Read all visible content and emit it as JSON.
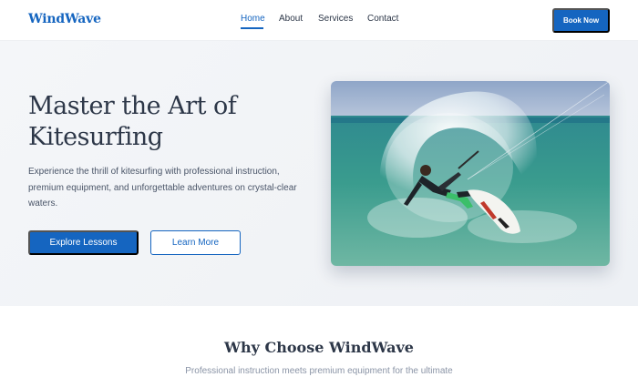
{
  "header": {
    "logo": "WindWave",
    "nav": [
      {
        "label": "Home",
        "active": true
      },
      {
        "label": "About",
        "active": false
      },
      {
        "label": "Services",
        "active": false
      },
      {
        "label": "Contact",
        "active": false
      }
    ],
    "cta": "Book Now"
  },
  "hero": {
    "title_line1": "Master the Art of",
    "title_line2": "Kitesurfing",
    "description": "Experience the thrill of kitesurfing with professional instruction, premium equipment, and unforgettable adventures on crystal-clear waters.",
    "primary_button": "Explore Lessons",
    "secondary_button": "Learn More",
    "image_subject": "kitesurfer-carving-wave-photo"
  },
  "why": {
    "title": "Why Choose WindWave",
    "subtitle": "Professional instruction meets premium equipment for the ultimate"
  },
  "colors": {
    "brand": "#1565c0",
    "text": "#2d3748",
    "muted": "#4a5568",
    "hero_bg": "#f2f4f7"
  }
}
